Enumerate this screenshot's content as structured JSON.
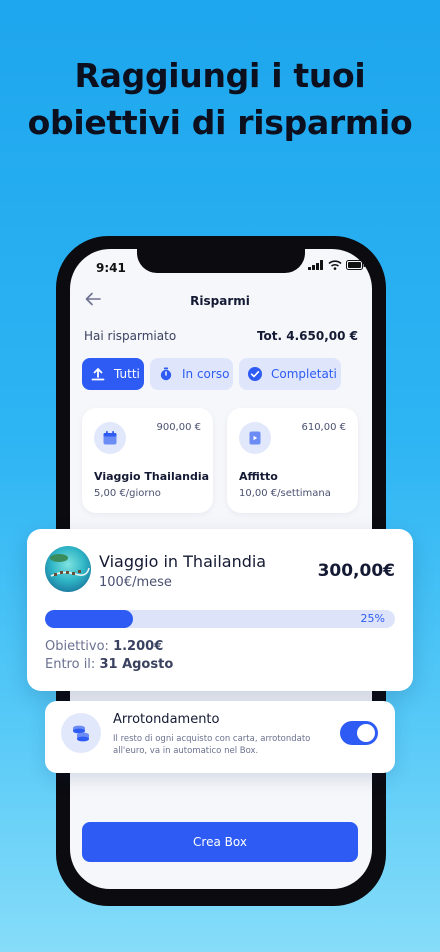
{
  "headline": {
    "line1": "Raggiungi i tuoi",
    "line2": "obiettivi di risparmio"
  },
  "status_bar": {
    "time": "9:41",
    "icons": [
      "signal-icon",
      "wifi-icon",
      "battery-icon"
    ]
  },
  "header": {
    "back_icon": "arrow-left-icon",
    "title": "Risparmi"
  },
  "summary": {
    "label": "Hai risparmiato",
    "total": "Tot. 4.650,00 €"
  },
  "tabs": [
    {
      "label": "Tutti",
      "icon": "upload-icon",
      "active": true
    },
    {
      "label": "In corso",
      "icon": "stopwatch-icon",
      "active": false
    },
    {
      "label": "Completati",
      "icon": "check-circle-icon",
      "active": false
    }
  ],
  "boxes": [
    {
      "amount": "900,00 €",
      "name": "Viaggio Thailandia",
      "rate": "5,00 €/giorno",
      "icon": "calendar-icon"
    },
    {
      "amount": "610,00 €",
      "name": "Affitto",
      "rate": "10,00 €/settimana",
      "icon": "document-icon"
    }
  ],
  "goal": {
    "title": "Viaggio in Thailandia",
    "subtitle": "100€/mese",
    "amount": "300,00€",
    "progress_percent": 25,
    "progress_label": "25%",
    "target_label": "Obiettivo:",
    "target_value": "1.200€",
    "deadline_label": "Entro il:",
    "deadline_value": "31 Agosto"
  },
  "rounding": {
    "title": "Arrotondamento",
    "description": "Il resto di ogni acquisto con carta, arrotondato all'euro, va in automatico nel Box.",
    "enabled": true,
    "icon": "coins-icon"
  },
  "cta": {
    "label": "Crea Box"
  },
  "colors": {
    "accent": "#2d5bf3",
    "accent_light": "#dfe6fb",
    "background_top": "#1ea6ee",
    "background_bottom": "#86dcf9"
  }
}
